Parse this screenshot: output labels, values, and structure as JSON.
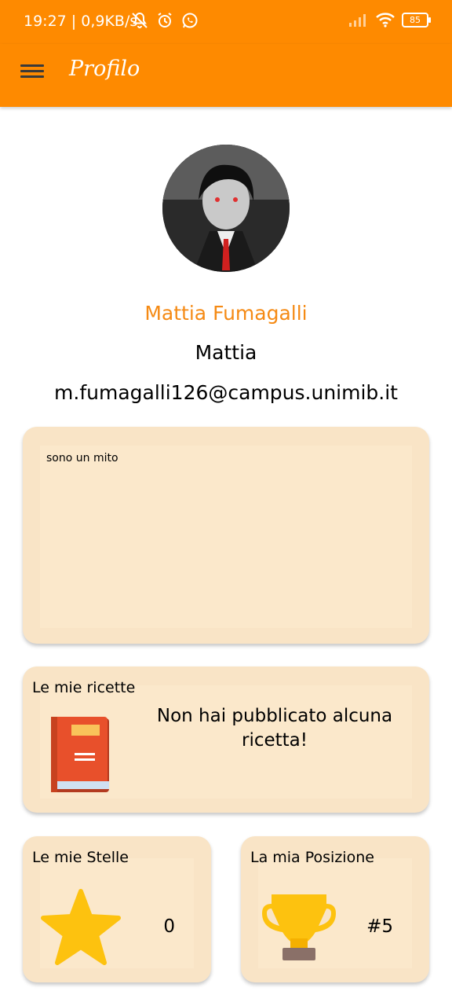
{
  "status_bar": {
    "time": "19:27 | 0,9KB/s",
    "battery": "85"
  },
  "app_bar": {
    "title": "Profilo",
    "menu_icon": "hamburger-menu-icon"
  },
  "profile": {
    "avatar": "profile-avatar",
    "name": "Mattia Fumagalli",
    "username": "Mattia",
    "email": "m.fumagalli126@campus.unimib.it",
    "bio": "sono un mito"
  },
  "recipes": {
    "title": "Le mie ricette",
    "empty_message": "Non hai pubblicato alcuna ricetta!",
    "icon": "book-icon"
  },
  "stars": {
    "title": "Le mie Stelle",
    "value": "0",
    "icon": "star-icon"
  },
  "position": {
    "title": "La mia Posizione",
    "value": "#5",
    "icon": "trophy-icon"
  },
  "colors": {
    "accent": "#fe8a00",
    "name_color": "#f58a14",
    "card_bg": "#f9e4c6"
  }
}
